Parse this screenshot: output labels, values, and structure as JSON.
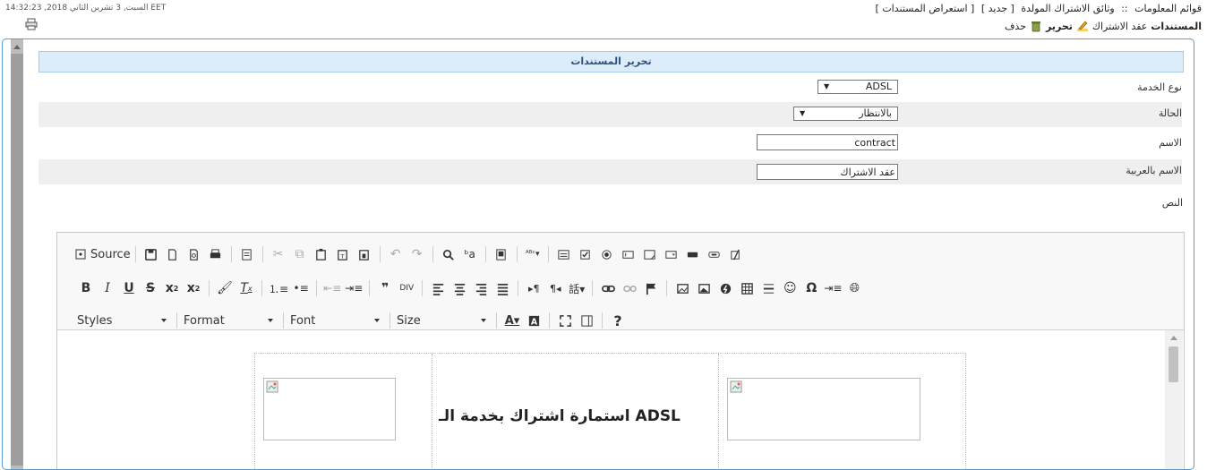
{
  "header": {
    "timestamp": "السبت, 3 تشرين الثاني 2018, 14:32:23 EET",
    "breadcrumb": [
      "قوائم المعلومات",
      "::",
      "وثائق الاشتراك المولدة",
      "[ جديد ]",
      "[ استعراض المستندات ]"
    ],
    "section_label": "المستندات",
    "record_name": "عقد الاشتراك",
    "edit_label": "تحرير",
    "delete_label": "حذف"
  },
  "form": {
    "title": "تحرير المستندات",
    "service_type": {
      "label": "نوع الخدمة",
      "value": "ADSL"
    },
    "status": {
      "label": "الحالة",
      "value": "بالانتظار"
    },
    "name": {
      "label": "الاسم",
      "value": "contract"
    },
    "arabic_name": {
      "label": "الاسم بالعربية",
      "value": "عقد الاشتراك"
    },
    "text_label": "النص"
  },
  "editor": {
    "source_label": "Source",
    "styles_label": "Styles",
    "format_label": "Format",
    "font_label": "Font",
    "size_label": "Size",
    "doc_heading": "ADSL استمارة اشتراك بخدمة الـ"
  },
  "colors": {
    "accent": "#5a9bd4",
    "title_bar": "#dcecf9",
    "title_text": "#2f4f7f"
  }
}
